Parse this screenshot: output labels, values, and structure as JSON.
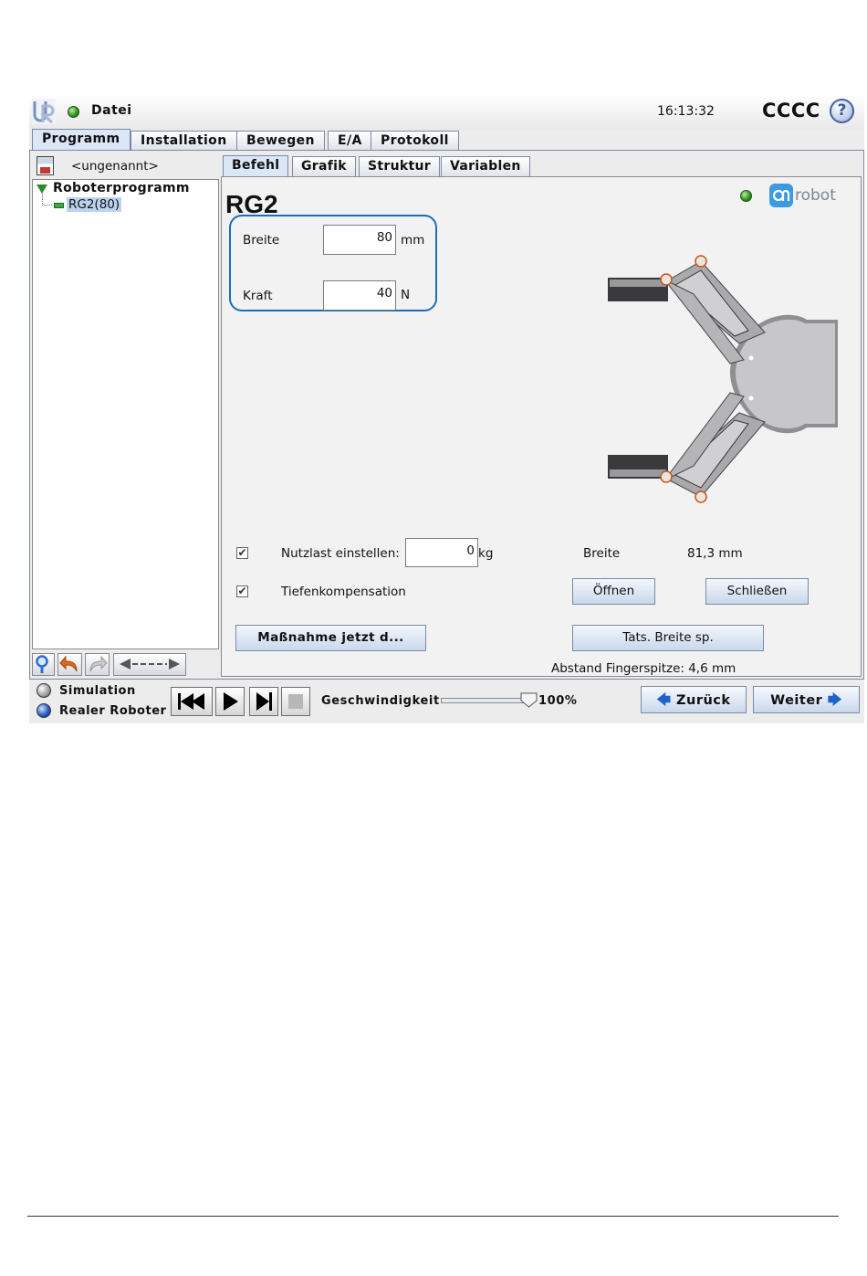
{
  "header": {
    "file_label": "Datei",
    "time": "16:13:32",
    "robot_name": "CCCC",
    "help_symbol": "?",
    "ur_logo_icon": "ur-logo-icon",
    "status_color": "#2f9a1c"
  },
  "main_tabs": [
    {
      "label": "Programm",
      "active": true
    },
    {
      "label": "Installation"
    },
    {
      "label": "Bewegen"
    },
    {
      "label": "E/A"
    },
    {
      "label": "Protokoll"
    }
  ],
  "left_panel": {
    "program_name": "<ungenannt>",
    "tree_root": "Roboterprogramm",
    "tree_child": "RG2(80)"
  },
  "sub_tabs": [
    {
      "label": "Befehl",
      "active": true
    },
    {
      "label": "Grafik"
    },
    {
      "label": "Struktur"
    },
    {
      "label": "Variablen"
    }
  ],
  "command": {
    "title": "RG2",
    "brand": "robot",
    "width_label": "Breite",
    "width_value": "80",
    "width_unit": "mm",
    "force_label": "Kraft",
    "force_value": "40",
    "force_unit": "N",
    "payload_label": "Nutzlast einstellen:",
    "payload_value": "0",
    "payload_unit": "kg",
    "payload_checked": true,
    "depth_label": "Tiefenkompensation",
    "depth_checked": true,
    "current_width_label": "Breite",
    "current_width_value": "81,3 mm",
    "open_button": "Öffnen",
    "close_button": "Schließen",
    "action_button": "Maßnahme jetzt d...",
    "save_width_button": "Tats. Breite sp.",
    "fingertip_distance": "Abstand Fingerspitze: 4,6 mm"
  },
  "bottom_bar": {
    "simulation_label": "Simulation",
    "real_robot_label": "Realer Roboter",
    "speed_label": "Geschwindigkeit",
    "speed_value": "100%",
    "speed_fraction": 1.0,
    "back_button": "Zurück",
    "next_button": "Weiter"
  }
}
